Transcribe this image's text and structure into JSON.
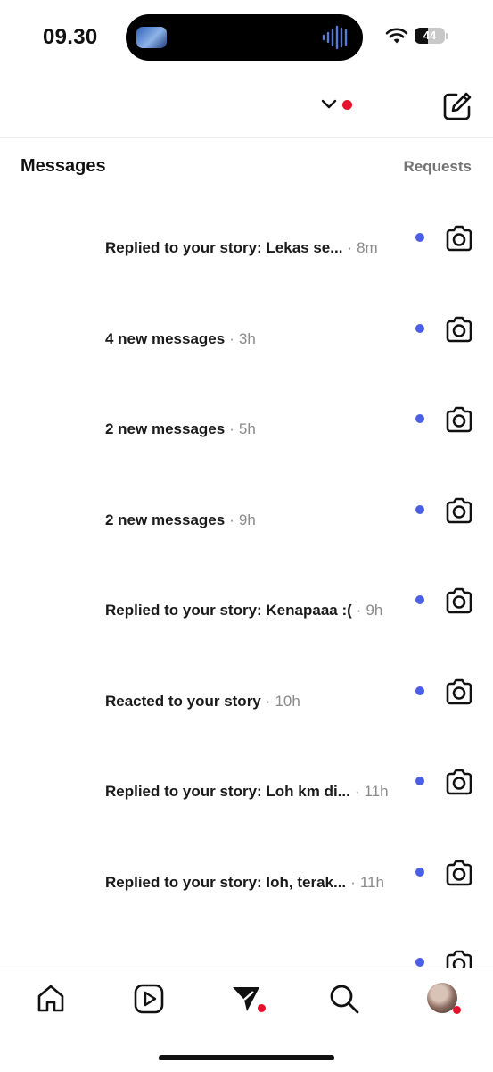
{
  "status_bar": {
    "time": "09.30",
    "battery": "44",
    "battery_level": 0.44
  },
  "header": {
    "account_name": "",
    "colors": {
      "notification_dot": "#e8112d",
      "unread_dot": "#4a5fe6"
    }
  },
  "messages_section": {
    "title": "Messages",
    "requests_label": "Requests"
  },
  "threads": [
    {
      "preview": "Replied to your story: Lekas se...",
      "time": "8m",
      "unread": true
    },
    {
      "preview": "4 new messages",
      "time": "3h",
      "unread": true
    },
    {
      "preview": "2 new messages",
      "time": "5h",
      "unread": true
    },
    {
      "preview": "2 new messages",
      "time": "9h",
      "unread": true
    },
    {
      "preview": "Replied to your story: Kenapaaa :(",
      "time": "9h",
      "unread": true
    },
    {
      "preview": "Reacted to your story",
      "time": "10h",
      "unread": true
    },
    {
      "preview": "Replied to your story: Loh km di...",
      "time": "11h",
      "unread": true
    },
    {
      "preview": "Replied to your story: loh, terak...",
      "time": "11h",
      "unread": true
    },
    {
      "preview": "",
      "time": "",
      "unread": true
    }
  ],
  "separator": "·",
  "tab_bar": {
    "items": [
      {
        "icon": "home-icon"
      },
      {
        "icon": "reels-icon"
      },
      {
        "icon": "direct-messages-icon",
        "active": true,
        "badge": true
      },
      {
        "icon": "search-icon"
      },
      {
        "icon": "profile-avatar",
        "badge": true
      }
    ]
  }
}
